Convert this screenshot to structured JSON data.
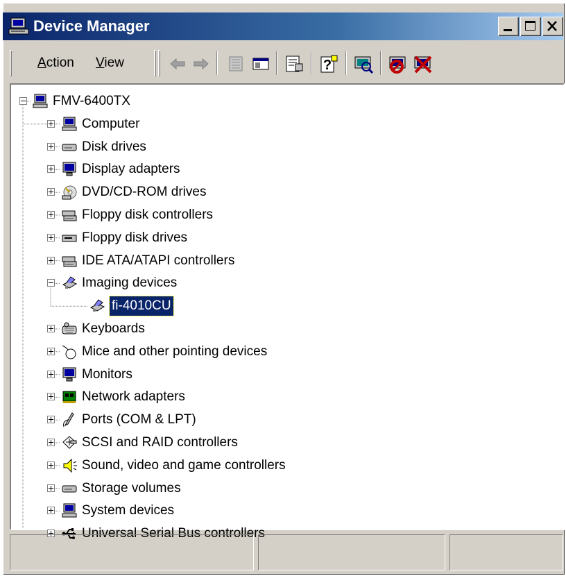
{
  "window": {
    "title": "Device Manager"
  },
  "caption_buttons": {
    "minimize": "minimize-icon",
    "maximize": "maximize-icon",
    "close": "close-icon"
  },
  "toolbar": {
    "menus": [
      {
        "label": "Action",
        "accel": "A"
      },
      {
        "label": "View",
        "accel": "V"
      }
    ],
    "buttons": [
      "back-arrow-icon",
      "forward-arrow-icon",
      "folder-grid-icon",
      "show-hide-pane-icon",
      "properties-icon",
      "help-icon",
      "scan-hardware-icon",
      "disable-device-icon",
      "uninstall-device-icon"
    ]
  },
  "tree": {
    "root": {
      "label": "FMV-6400TX",
      "icon": "computer-icon",
      "expanded": true
    },
    "items": [
      {
        "label": "Computer",
        "icon": "computer-icon",
        "expanded": false
      },
      {
        "label": "Disk drives",
        "icon": "disk-drive-icon",
        "expanded": false
      },
      {
        "label": "Display adapters",
        "icon": "monitor-icon",
        "expanded": false
      },
      {
        "label": "DVD/CD-ROM drives",
        "icon": "cdrom-icon",
        "expanded": false
      },
      {
        "label": "Floppy disk controllers",
        "icon": "controller-icon",
        "expanded": false
      },
      {
        "label": "Floppy disk drives",
        "icon": "floppy-drive-icon",
        "expanded": false
      },
      {
        "label": "IDE ATA/ATAPI controllers",
        "icon": "controller-icon",
        "expanded": false
      },
      {
        "label": "Imaging devices",
        "icon": "scanner-icon",
        "expanded": true
      },
      {
        "label": "fi-4010CU",
        "icon": "scanner-icon",
        "child": true,
        "selected": true
      },
      {
        "label": "Keyboards",
        "icon": "keyboard-icon",
        "expanded": false
      },
      {
        "label": "Mice and other pointing devices",
        "icon": "mouse-icon",
        "expanded": false
      },
      {
        "label": "Monitors",
        "icon": "monitor-icon",
        "expanded": false
      },
      {
        "label": "Network adapters",
        "icon": "network-card-icon",
        "expanded": false
      },
      {
        "label": "Ports (COM & LPT)",
        "icon": "port-icon",
        "expanded": false
      },
      {
        "label": "SCSI and RAID controllers",
        "icon": "scsi-icon",
        "expanded": false
      },
      {
        "label": "Sound, video and game controllers",
        "icon": "speaker-icon",
        "expanded": false
      },
      {
        "label": "Storage volumes",
        "icon": "disk-drive-icon",
        "expanded": false
      },
      {
        "label": "System devices",
        "icon": "computer-icon",
        "expanded": false
      },
      {
        "label": "Universal Serial Bus controllers",
        "icon": "usb-icon",
        "expanded": false
      }
    ]
  },
  "statusbar": {
    "panes": [
      "",
      "",
      ""
    ]
  },
  "colors": {
    "titlebar_start": "#0a246a",
    "titlebar_end": "#a6caf0",
    "selection": "#0a246a",
    "face": "#d4d0c8"
  }
}
